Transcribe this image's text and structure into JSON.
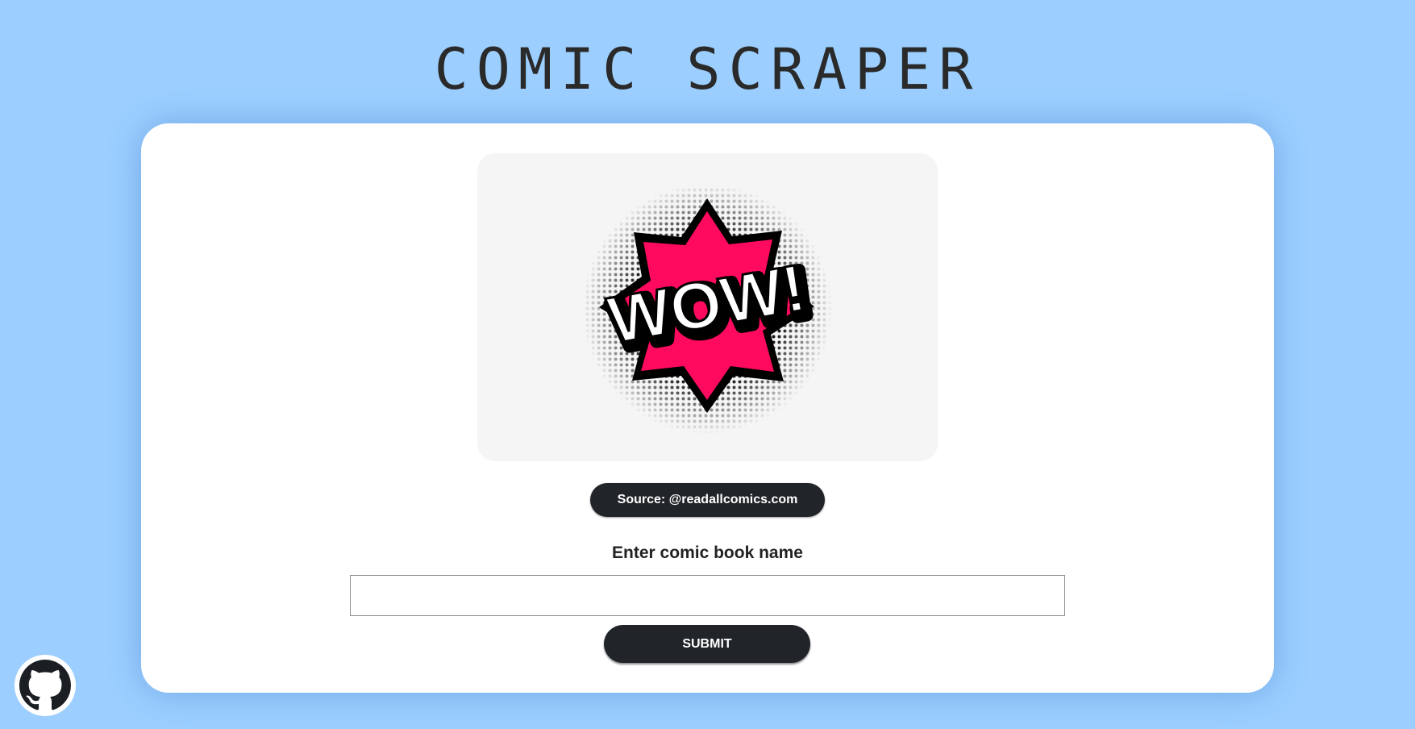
{
  "header": {
    "title": "COMIC SCRAPER"
  },
  "hero": {
    "image_text": "WOW!",
    "icon": "comic-burst-image"
  },
  "source": {
    "label": "Source: @readallcomics.com"
  },
  "form": {
    "label": "Enter comic book name",
    "input_value": "",
    "input_placeholder": "",
    "submit_label": "SUBMIT"
  },
  "footer": {
    "github_icon": "github-icon"
  },
  "colors": {
    "background": "#9ccfff",
    "card": "#ffffff",
    "button": "#212529",
    "burst": "#ff0a5f"
  }
}
